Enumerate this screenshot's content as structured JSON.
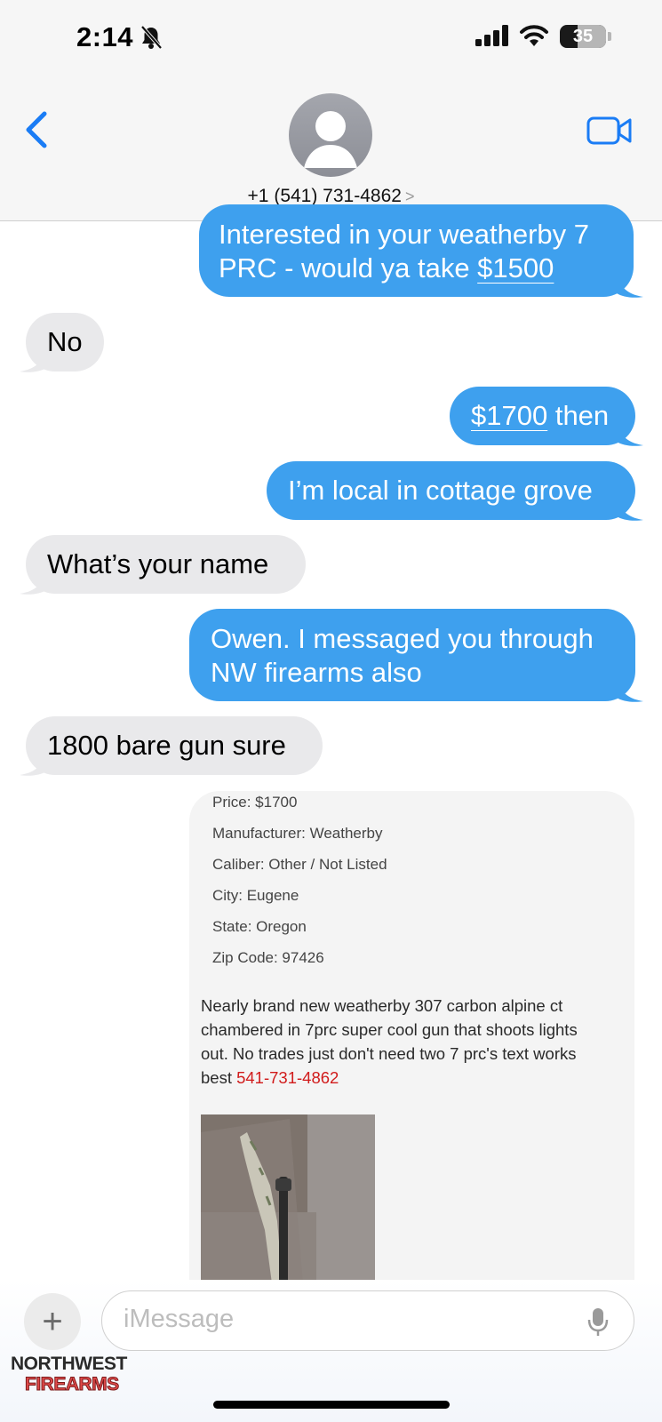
{
  "status": {
    "time": "2:14",
    "battery": "35"
  },
  "contact": {
    "phone": "+1 (541) 731-4862",
    "chevron": ">"
  },
  "messages": {
    "m1_line1": "Interested in your weatherby 7",
    "m1_line2_pre": "PRC - would ya take ",
    "m1_line2_link": "$1500",
    "m2": "No",
    "m3_link": "$1700",
    "m3_rest": " then",
    "m4": "I’m local in cottage grove",
    "m5": "What’s your name",
    "m6_line1": "Owen. I messaged you through",
    "m6_line2": "NW firearms also",
    "m7": "1800 bare gun sure"
  },
  "listing": {
    "price": "Price: $1700",
    "manufacturer": "Manufacturer: Weatherby",
    "caliber": "Caliber: Other / Not Listed",
    "city": "City: Eugene",
    "state": "State: Oregon",
    "zip": "Zip Code: 97426",
    "desc_line1": "Nearly brand new weatherby 307 carbon alpine ct",
    "desc_line2": "chambered in 7prc super cool gun that shoots lights",
    "desc_line3": "out. No trades just don't need two 7 prc's text works",
    "desc_line4_pre": "best ",
    "desc_phone": "541-731-4862"
  },
  "input": {
    "placeholder": "iMessage",
    "plus": "+"
  },
  "watermark": {
    "line1": "NORTHWEST",
    "line2": "FIREARMS"
  },
  "colors": {
    "outgoing": "#3ea0ee",
    "incoming": "#e9e9eb",
    "accent": "#1a7cf5"
  },
  "icons": [
    "bell-slash-icon",
    "signal-icon",
    "wifi-icon",
    "battery-icon",
    "back-chevron-icon",
    "avatar-icon",
    "video-camera-icon",
    "plus-icon",
    "microphone-icon"
  ]
}
